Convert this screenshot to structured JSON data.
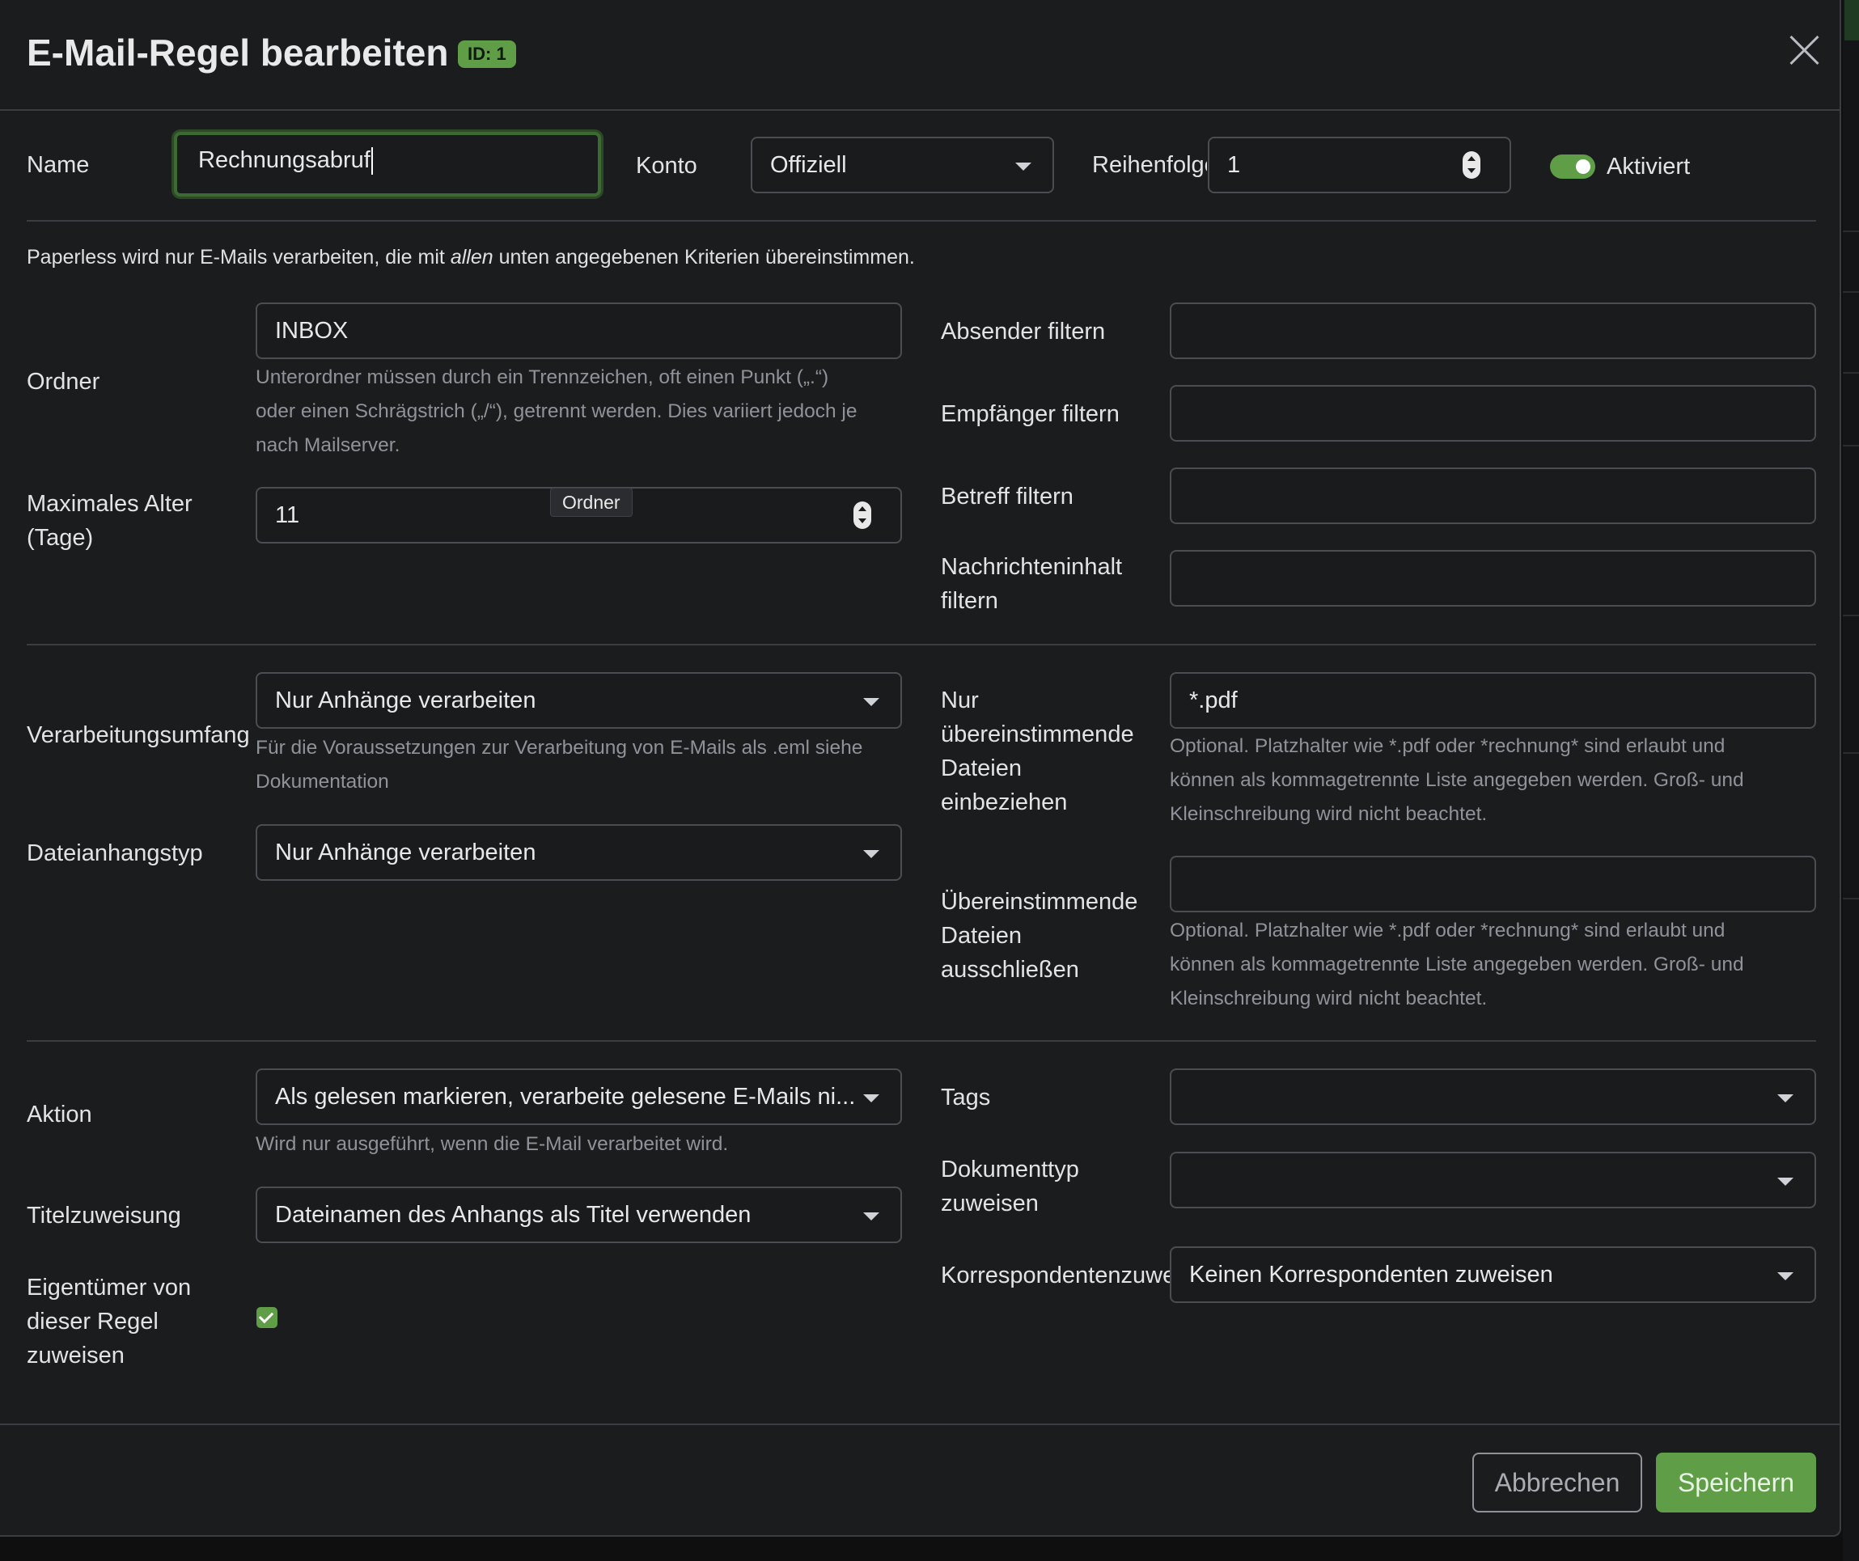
{
  "dialog": {
    "title": "E-Mail-Regel bearbeiten",
    "id_badge": "ID: 1",
    "close_label": "×"
  },
  "top": {
    "name_label": "Name",
    "name_value": "Rechnungsabruf",
    "konto_label": "Konto",
    "konto_value": "Offiziell",
    "reihenfolge_label": "Reihenfolge",
    "reihenfolge_value": "1",
    "aktiviert_label": "Aktiviert",
    "aktiviert": true
  },
  "note": {
    "before": "Paperless wird nur E-Mails verarbeiten, die mit ",
    "emph": "allen",
    "after": " unten angegebenen Kriterien übereinstimmen."
  },
  "left": {
    "ordner_label": "Ordner",
    "ordner_value": "INBOX",
    "ordner_help": [
      "Unterordner müssen durch ein Trennzeichen, oft einen Punkt („.“)",
      "oder einen Schrägstrich („/“), getrennt werden. Dies variiert jedoch je",
      "nach Mailserver."
    ],
    "alter_label": [
      "Maximales Alter",
      "(Tage)"
    ],
    "alter_value": "11",
    "tooltip": "Ordner",
    "umfang_label": "Verarbeitungsumfang",
    "umfang_value": "Nur Anhänge verarbeiten",
    "umfang_help": [
      "Für die Voraussetzungen zur Verarbeitung von E-Mails als .eml siehe",
      "Dokumentation"
    ],
    "anhangstyp_label": "Dateianhangstyp",
    "anhangstyp_value": "Nur Anhänge verarbeiten",
    "aktion_label": "Aktion",
    "aktion_value": "Als gelesen markieren, verarbeite gelesene E-Mails ni...",
    "aktion_help": "Wird nur ausgeführt, wenn die E-Mail verarbeitet wird.",
    "titel_label": "Titelzuweisung",
    "titel_value": "Dateinamen des Anhangs als Titel verwenden",
    "eigentuemer_label": [
      "Eigentümer von",
      "dieser Regel",
      "zuweisen"
    ],
    "eigentuemer_checked": true
  },
  "right": {
    "absender_label": "Absender filtern",
    "absender_value": "",
    "empfaenger_label": "Empfänger filtern",
    "empfaenger_value": "",
    "betreff_label": "Betreff filtern",
    "betreff_value": "",
    "inhalt_label": [
      "Nachrichteninhalt",
      "filtern"
    ],
    "inhalt_value": "",
    "einbeziehen_label": [
      "Nur",
      "übereinstimmende",
      "Dateien",
      "einbeziehen"
    ],
    "einbeziehen_value": "*.pdf",
    "einbeziehen_help": [
      "Optional. Platzhalter wie *.pdf oder *rechnung* sind erlaubt und",
      "können als kommagetrennte Liste angegeben werden. Groß- und",
      "Kleinschreibung wird nicht beachtet."
    ],
    "ausschliessen_label": [
      "Übereinstimmende",
      "Dateien",
      "ausschließen"
    ],
    "ausschliessen_value": "",
    "ausschliessen_help": [
      "Optional. Platzhalter wie *.pdf oder *rechnung* sind erlaubt und",
      "können als kommagetrennte Liste angegeben werden. Groß- und",
      "Kleinschreibung wird nicht beachtet."
    ],
    "tags_label": "Tags",
    "tags_value": "",
    "dokumenttyp_label": [
      "Dokumenttyp",
      "zuweisen"
    ],
    "dokumenttyp_value": "",
    "korrespondent_label": "Korrespondentenzuweisung",
    "korrespondent_value": "Keinen Korrespondenten zuweisen"
  },
  "footer": {
    "cancel_label": "Abbrechen",
    "save_label": "Speichern"
  },
  "colors": {
    "accent": "#5f9d47",
    "background": "#1b1c1e",
    "border": "#4a4d52"
  }
}
